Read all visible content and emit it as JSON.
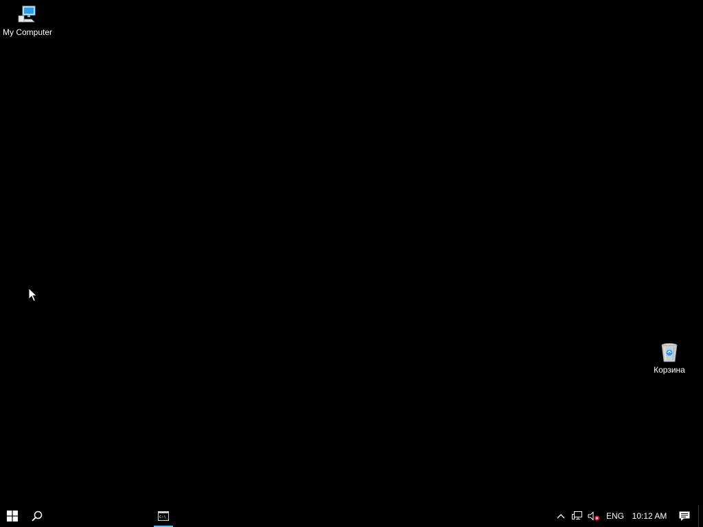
{
  "desktop": {
    "background": "#000000",
    "icons": [
      {
        "label": "My Computer",
        "icon": "computer-icon"
      },
      {
        "label": "Корзина",
        "icon": "recycle-bin-icon"
      }
    ]
  },
  "taskbar": {
    "start_icon": "windows-logo-icon",
    "search_icon": "search-icon",
    "running_apps": [
      {
        "icon": "command-prompt-icon",
        "active": true,
        "accent": "#4cc2ff"
      }
    ],
    "tray": {
      "chevron_icon": "chevron-up-icon",
      "network_icon": "network-icon",
      "volume_icon": "volume-muted-icon",
      "language": "ENG",
      "time": "10:12 AM",
      "notification_icon": "action-center-icon"
    }
  }
}
